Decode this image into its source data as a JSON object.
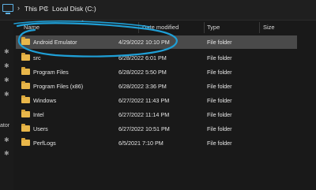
{
  "address_bar": {
    "crumbs": [
      "This PC",
      "Local Disk (C:)"
    ]
  },
  "columns": {
    "name": "Name",
    "date_modified": "Date modified",
    "type": "Type",
    "size": "Size"
  },
  "nav": {
    "edge_label": "ator"
  },
  "rows": [
    {
      "name": "Android Emulator",
      "date": "4/29/2022 10:10 PM",
      "type": "File folder",
      "selected": true
    },
    {
      "name": "src",
      "date": "6/28/2022 6:01 PM",
      "type": "File folder"
    },
    {
      "name": "Program Files",
      "date": "6/28/2022 5:50 PM",
      "type": "File folder"
    },
    {
      "name": "Program Files (x86)",
      "date": "6/28/2022 3:36 PM",
      "type": "File folder"
    },
    {
      "name": "Windows",
      "date": "6/27/2022 11:43 PM",
      "type": "File folder"
    },
    {
      "name": "Intel",
      "date": "6/27/2022 11:14 PM",
      "type": "File folder"
    },
    {
      "name": "Users",
      "date": "6/27/2022 10:51 PM",
      "type": "File folder"
    },
    {
      "name": "PerfLogs",
      "date": "6/5/2021 7:10 PM",
      "type": "File folder"
    }
  ],
  "colors": {
    "background": "#191919",
    "selected_row": "#4a4a4a",
    "folder": "#e9b74a",
    "annotation": "#1f9fd6"
  },
  "icons": {
    "address": "pc-icon",
    "separator": "chevron-right-icon",
    "folder": "folder-icon",
    "pin": "pin-icon"
  }
}
